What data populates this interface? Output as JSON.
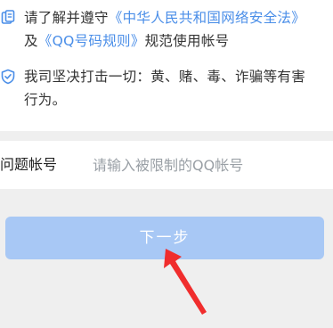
{
  "notice": {
    "line1_prefix": "请了解并遵守",
    "line1_link": "《中华人民共和国网络安全法》",
    "line2_prefix": "及",
    "line2_link": "《QQ号码规则》",
    "line2_suffix": "规范使用帐号",
    "line3": "我司坚决打击一切：黄、赌、毒、诈骗等有害",
    "line4": "行为。",
    "icon1": "document-icon",
    "icon2": "shield-icon"
  },
  "form": {
    "label": "问题帐号",
    "placeholder": "请输入被限制的QQ帐号",
    "value": ""
  },
  "button": {
    "next_label": "下一步"
  },
  "colors": {
    "link": "#4a8ee8",
    "button_bg": "#a8c8f5",
    "page_bg": "#efefef",
    "arrow": "#f02d2d"
  }
}
